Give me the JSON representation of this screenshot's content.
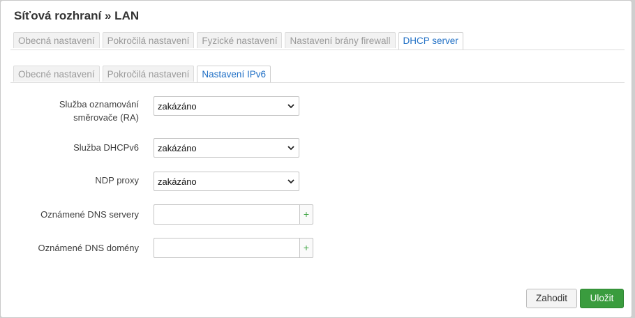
{
  "modal": {
    "title": "Síťová rozhraní » LAN"
  },
  "primary_tabs": [
    {
      "label": "Obecná nastavení",
      "active": false
    },
    {
      "label": "Pokročilá nastavení",
      "active": false
    },
    {
      "label": "Fyzické nastavení",
      "active": false
    },
    {
      "label": "Nastavení brány firewall",
      "active": false
    },
    {
      "label": "DHCP server",
      "active": true
    }
  ],
  "secondary_tabs": [
    {
      "label": "Obecné nastavení",
      "active": false
    },
    {
      "label": "Pokročilá nastavení",
      "active": false
    },
    {
      "label": "Nastavení IPv6",
      "active": true
    }
  ],
  "form": {
    "ra_service": {
      "label": "Služba oznamování směrovače (RA)",
      "value": "zakázáno"
    },
    "dhcpv6_service": {
      "label": "Služba DHCPv6",
      "value": "zakázáno"
    },
    "ndp_proxy": {
      "label": "NDP proxy",
      "value": "zakázáno"
    },
    "dns_servers": {
      "label": "Oznámené DNS servery",
      "value": "",
      "add_symbol": "+"
    },
    "dns_domains": {
      "label": "Oznámené DNS domény",
      "value": "",
      "add_symbol": "+"
    }
  },
  "buttons": {
    "cancel": "Zahodit",
    "save": "Uložit"
  },
  "colors": {
    "active_tab": "#1f6fc5",
    "save_button": "#3a9c3e",
    "add_icon": "#3fa543"
  }
}
